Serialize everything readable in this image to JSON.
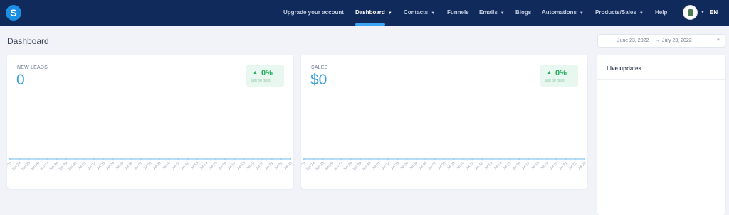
{
  "header": {
    "logo_letter": "S",
    "nav": [
      {
        "label": "Upgrade your account",
        "dropdown": false,
        "active": false
      },
      {
        "label": "Dashboard",
        "dropdown": true,
        "active": true
      },
      {
        "label": "Contacts",
        "dropdown": true,
        "active": false
      },
      {
        "label": "Funnels",
        "dropdown": false,
        "active": false
      },
      {
        "label": "Emails",
        "dropdown": true,
        "active": false
      },
      {
        "label": "Blogs",
        "dropdown": false,
        "active": false
      },
      {
        "label": "Automations",
        "dropdown": true,
        "active": false
      },
      {
        "label": "Products/Sales",
        "dropdown": true,
        "active": false
      },
      {
        "label": "Help",
        "dropdown": false,
        "active": false
      }
    ],
    "language": "EN"
  },
  "page": {
    "title": "Dashboard",
    "date_range": {
      "start": "June 23, 2022",
      "separator": "→",
      "end": "July 23, 2022"
    }
  },
  "cards": {
    "leads": {
      "label": "NEW LEADS",
      "value": "0",
      "trend_pct": "0%",
      "trend_period": "last 30 days"
    },
    "sales": {
      "label": "SALES",
      "value": "$0",
      "trend_pct": "0%",
      "trend_period": "last 30 days"
    }
  },
  "live_updates": {
    "title": "Live updates"
  },
  "chart_dates": [
    "Jun 23",
    "Jun 24",
    "Jun 25",
    "Jun 26",
    "Jun 27",
    "Jun 28",
    "Jun 29",
    "Jun 30",
    "Jul 01",
    "Jul 02",
    "Jul 03",
    "Jul 04",
    "Jul 05",
    "Jul 06",
    "Jul 07",
    "Jul 08",
    "Jul 09",
    "Jul 10",
    "Jul 11",
    "Jul 12",
    "Jul 13",
    "Jul 14",
    "Jul 15",
    "Jul 16",
    "Jul 17",
    "Jul 18",
    "Jul 19",
    "Jul 20",
    "Jul 21",
    "Jul 22",
    "Jul 23"
  ],
  "chart_data": [
    {
      "type": "line",
      "series": [
        {
          "values": [
            0,
            0,
            0,
            0,
            0,
            0,
            0,
            0,
            0,
            0,
            0,
            0,
            0,
            0,
            0,
            0,
            0,
            0,
            0,
            0,
            0,
            0,
            0,
            0,
            0,
            0,
            0,
            0,
            0,
            0,
            0
          ]
        }
      ]
    },
    {
      "type": "line",
      "series": [
        {
          "values": [
            0,
            0,
            0,
            0,
            0,
            0,
            0,
            0,
            0,
            0,
            0,
            0,
            0,
            0,
            0,
            0,
            0,
            0,
            0,
            0,
            0,
            0,
            0,
            0,
            0,
            0,
            0,
            0,
            0,
            0,
            0
          ]
        }
      ]
    }
  ],
  "colors": {
    "header_bg": "#102a5c",
    "accent": "#3aa0e0",
    "positive": "#27ae60",
    "positive_bg": "#e8f7ef",
    "line": "#9fd1f4"
  },
  "icons": {
    "up": "▲",
    "caret": "▼"
  }
}
